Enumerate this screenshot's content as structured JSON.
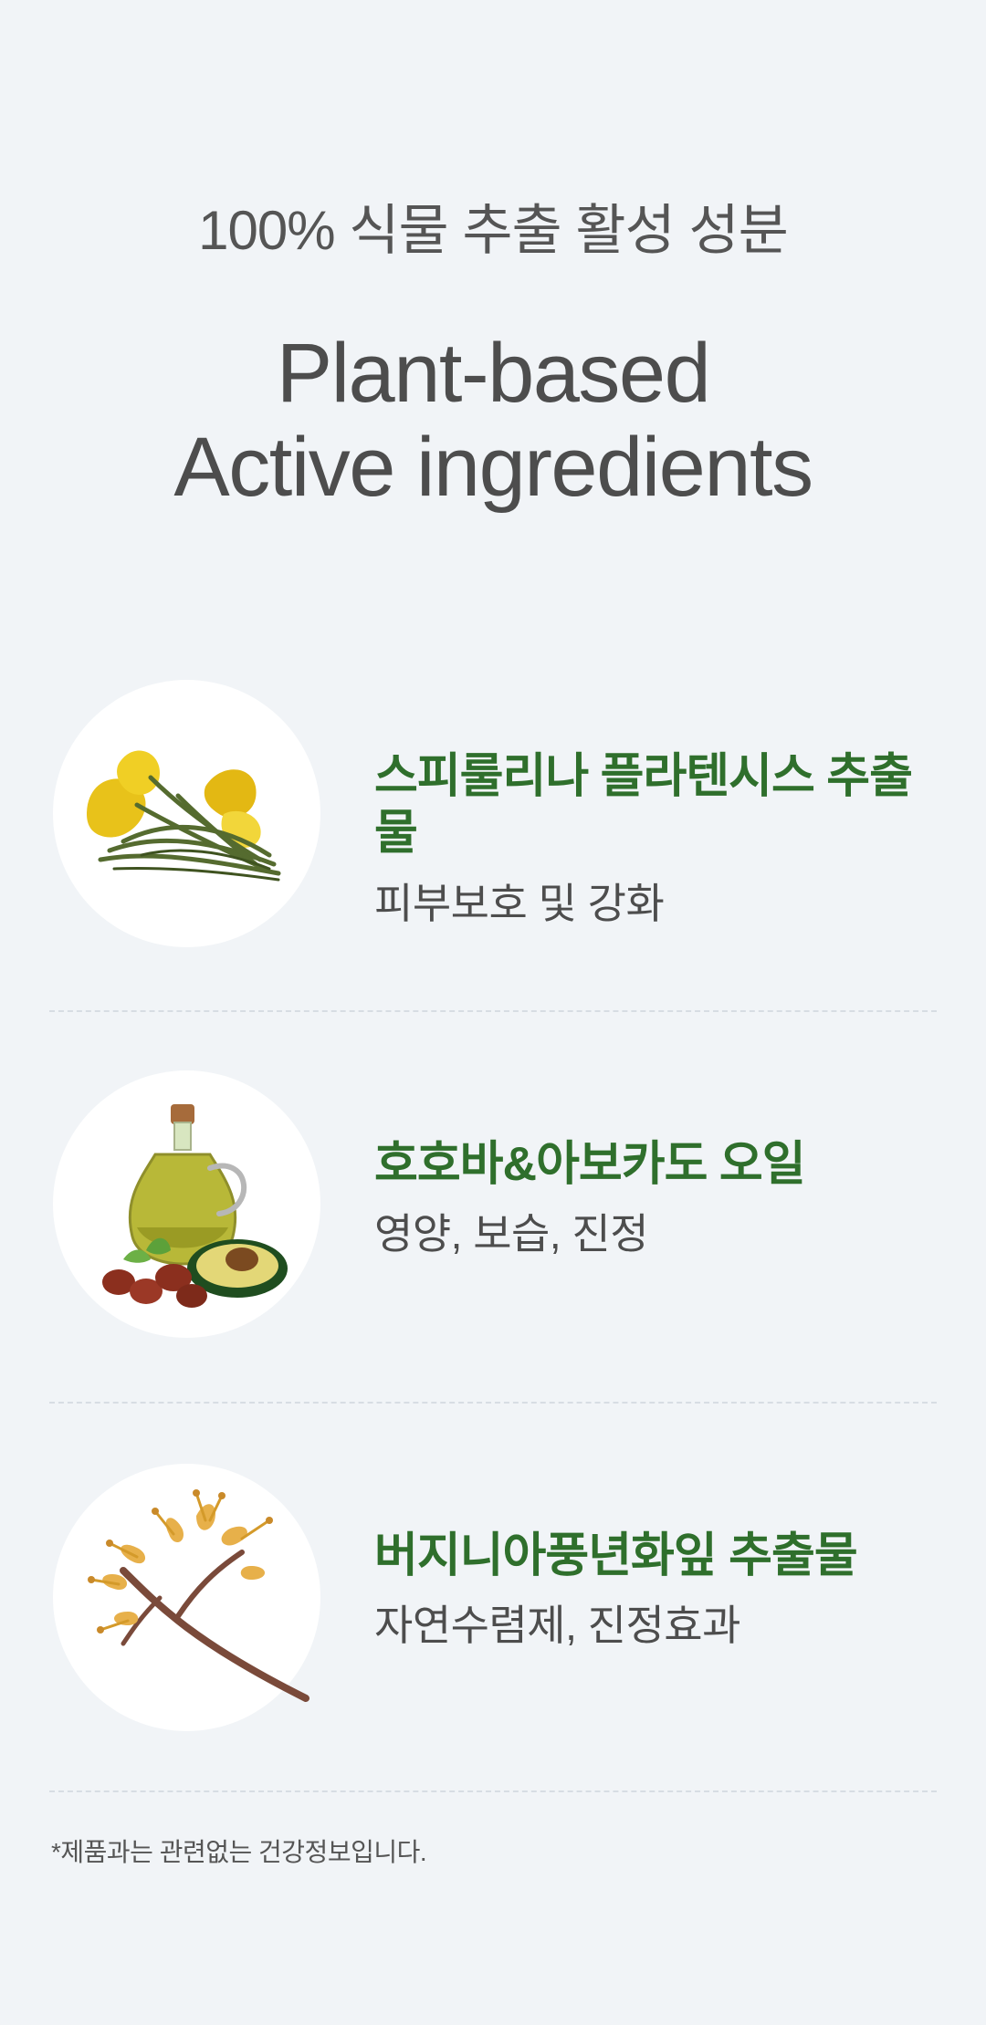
{
  "header": {
    "kicker": "100% 식물 추출 활성 성분",
    "title_line1": "Plant-based",
    "title_line2": "Active ingredients"
  },
  "ingredients": [
    {
      "name": "스피룰리나 플라텐시스 추출물",
      "desc": "피부보호 및 강화",
      "icon": "seaweed-icon"
    },
    {
      "name": "호호바&아보카도 오일",
      "desc": "영양, 보습, 진정",
      "icon": "oil-avocado-icon"
    },
    {
      "name": "버지니아풍년화잎 추출물",
      "desc": "자연수렴제, 진정효과",
      "icon": "witch-hazel-icon"
    }
  ],
  "footnote": "*제품과는 관련없는 건강정보입니다.",
  "colors": {
    "background": "#f1f4f7",
    "accent_green": "#2f6f2c",
    "text_gray": "#4d4d4d",
    "divider": "#d7dde3"
  }
}
